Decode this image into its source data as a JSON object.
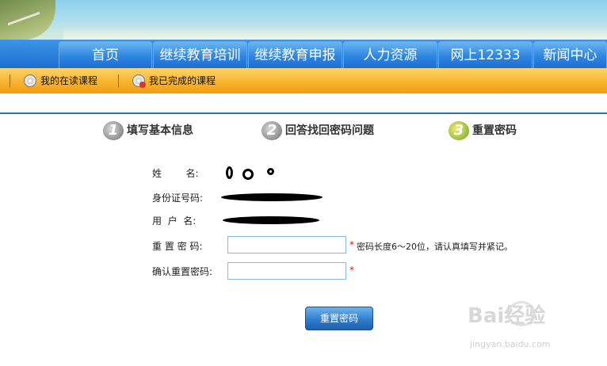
{
  "nav": {
    "tabs": [
      "首页",
      "继续教育培训",
      "继续教育申报",
      "人力资源",
      "网上12333",
      "新闻中心"
    ]
  },
  "subnav": {
    "items": [
      {
        "label": "我的在读课程",
        "icon": "disc-icon"
      },
      {
        "label": "我已完成的课程",
        "icon": "disc-complete-icon"
      }
    ]
  },
  "steps": [
    {
      "num": "1",
      "label": "填写基本信息"
    },
    {
      "num": "2",
      "label": "回答找回密码问题"
    },
    {
      "num": "3",
      "label": "重置密码"
    }
  ],
  "form": {
    "name_label": "姓        名:",
    "id_label": "身份证号码:",
    "user_label": "用  户  名:",
    "reset_label": "重 置 密 码:",
    "confirm_label": "确认重置密码:",
    "required_mark": "*",
    "password_hint": "密码长度6～20位，请认真填写并紧记。",
    "reset_value": "",
    "confirm_value": ""
  },
  "submit_label": "重置密码",
  "watermark": {
    "text": "Bai经验",
    "sub": "jingyan.baidu.com"
  },
  "colors": {
    "nav": "#2a7fdc",
    "subnav": "#f7b129",
    "divider": "#2a72c8",
    "required": "#e01010"
  }
}
